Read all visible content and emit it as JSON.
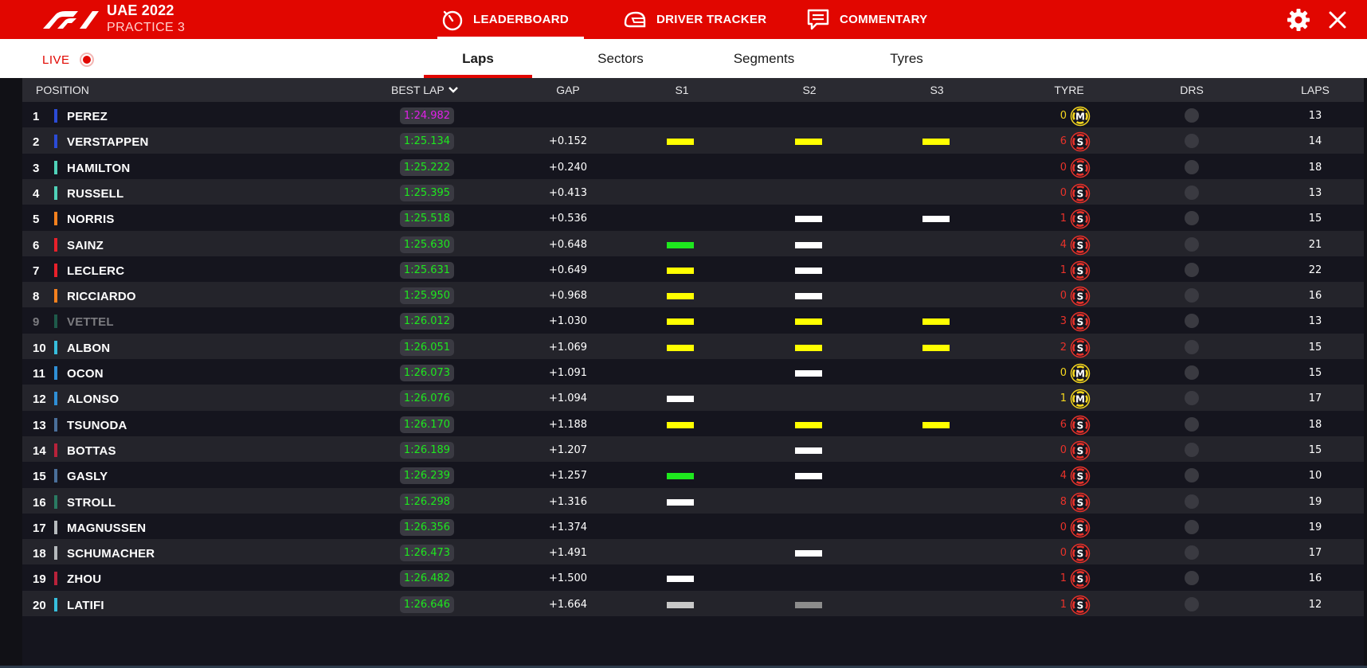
{
  "event": {
    "name": "UAE 2022",
    "session": "PRACTICE 3"
  },
  "main_tabs": [
    {
      "label": "LEADERBOARD",
      "icon": "stopwatch-icon",
      "active": true
    },
    {
      "label": "DRIVER TRACKER",
      "icon": "helmet-icon",
      "active": false
    },
    {
      "label": "COMMENTARY",
      "icon": "commentary-icon",
      "active": false
    }
  ],
  "live_label": "LIVE",
  "sub_tabs": [
    {
      "label": "Laps",
      "active": true
    },
    {
      "label": "Sectors",
      "active": false
    },
    {
      "label": "Segments",
      "active": false
    },
    {
      "label": "Tyres",
      "active": false
    }
  ],
  "headers": {
    "position": "POSITION",
    "best_lap": "BEST LAP",
    "gap": "GAP",
    "s1": "S1",
    "s2": "S2",
    "s3": "S3",
    "tyre": "TYRE",
    "drs": "DRS",
    "laps": "LAPS"
  },
  "colors": {
    "accent": "#e10600",
    "purple": "#e020e8",
    "green": "#1ee81e",
    "yellow": "#ffff00",
    "white": "#ffffff",
    "grey": "#c8c8c8",
    "dark_grey": "#8c8c8c",
    "tyre_soft": "#e8322a",
    "tyre_medium": "#f5d71e"
  },
  "rows": [
    {
      "pos": "1",
      "driver": "PEREZ",
      "team_color": "#2b4bd6",
      "best_lap": "1:24.982",
      "lap_color": "purple",
      "gap": "",
      "s1": null,
      "s2": null,
      "s3": null,
      "tyre_age": "0",
      "tyre": "M",
      "laps": "13"
    },
    {
      "pos": "2",
      "driver": "VERSTAPPEN",
      "team_color": "#2b4bd6",
      "best_lap": "1:25.134",
      "lap_color": "green",
      "gap": "+0.152",
      "s1": "yellow",
      "s2": "yellow",
      "s3": "yellow",
      "tyre_age": "6",
      "tyre": "S",
      "laps": "14"
    },
    {
      "pos": "3",
      "driver": "HAMILTON",
      "team_color": "#4fd1b8",
      "best_lap": "1:25.222",
      "lap_color": "green",
      "gap": "+0.240",
      "s1": null,
      "s2": null,
      "s3": null,
      "tyre_age": "0",
      "tyre": "S",
      "laps": "18"
    },
    {
      "pos": "4",
      "driver": "RUSSELL",
      "team_color": "#4fd1b8",
      "best_lap": "1:25.395",
      "lap_color": "green",
      "gap": "+0.413",
      "s1": null,
      "s2": null,
      "s3": null,
      "tyre_age": "0",
      "tyre": "S",
      "laps": "13"
    },
    {
      "pos": "5",
      "driver": "NORRIS",
      "team_color": "#f5811e",
      "best_lap": "1:25.518",
      "lap_color": "green",
      "gap": "+0.536",
      "s1": null,
      "s2": "white",
      "s3": "white",
      "tyre_age": "1",
      "tyre": "S",
      "laps": "15"
    },
    {
      "pos": "6",
      "driver": "SAINZ",
      "team_color": "#e8202a",
      "best_lap": "1:25.630",
      "lap_color": "green",
      "gap": "+0.648",
      "s1": "green",
      "s2": "white",
      "s3": null,
      "tyre_age": "4",
      "tyre": "S",
      "laps": "21"
    },
    {
      "pos": "7",
      "driver": "LECLERC",
      "team_color": "#e8202a",
      "best_lap": "1:25.631",
      "lap_color": "green",
      "gap": "+0.649",
      "s1": "yellow",
      "s2": "white",
      "s3": null,
      "tyre_age": "1",
      "tyre": "S",
      "laps": "22"
    },
    {
      "pos": "8",
      "driver": "RICCIARDO",
      "team_color": "#f5811e",
      "best_lap": "1:25.950",
      "lap_color": "green",
      "gap": "+0.968",
      "s1": "yellow",
      "s2": "white",
      "s3": null,
      "tyre_age": "0",
      "tyre": "S",
      "laps": "16"
    },
    {
      "pos": "9",
      "driver": "VETTEL",
      "team_color": "#1e5a4a",
      "best_lap": "1:26.012",
      "lap_color": "green",
      "gap": "+1.030",
      "s1": "yellow",
      "s2": "yellow",
      "s3": "yellow",
      "tyre_age": "3",
      "tyre": "S",
      "laps": "13",
      "dim": true
    },
    {
      "pos": "10",
      "driver": "ALBON",
      "team_color": "#37bedd",
      "best_lap": "1:26.051",
      "lap_color": "green",
      "gap": "+1.069",
      "s1": "yellow",
      "s2": "yellow",
      "s3": "yellow",
      "tyre_age": "2",
      "tyre": "S",
      "laps": "15"
    },
    {
      "pos": "11",
      "driver": "OCON",
      "team_color": "#2f8fd6",
      "best_lap": "1:26.073",
      "lap_color": "green",
      "gap": "+1.091",
      "s1": null,
      "s2": "white",
      "s3": null,
      "tyre_age": "0",
      "tyre": "M",
      "laps": "15"
    },
    {
      "pos": "12",
      "driver": "ALONSO",
      "team_color": "#2f8fd6",
      "best_lap": "1:26.076",
      "lap_color": "green",
      "gap": "+1.094",
      "s1": "white",
      "s2": null,
      "s3": null,
      "tyre_age": "1",
      "tyre": "M",
      "laps": "17"
    },
    {
      "pos": "13",
      "driver": "TSUNODA",
      "team_color": "#4a6f9a",
      "best_lap": "1:26.170",
      "lap_color": "green",
      "gap": "+1.188",
      "s1": "yellow",
      "s2": "yellow",
      "s3": "yellow",
      "tyre_age": "6",
      "tyre": "S",
      "laps": "18"
    },
    {
      "pos": "14",
      "driver": "BOTTAS",
      "team_color": "#b8223a",
      "best_lap": "1:26.189",
      "lap_color": "green",
      "gap": "+1.207",
      "s1": null,
      "s2": "white",
      "s3": null,
      "tyre_age": "0",
      "tyre": "S",
      "laps": "15"
    },
    {
      "pos": "15",
      "driver": "GASLY",
      "team_color": "#4a6f9a",
      "best_lap": "1:26.239",
      "lap_color": "green",
      "gap": "+1.257",
      "s1": "green",
      "s2": "white",
      "s3": null,
      "tyre_age": "4",
      "tyre": "S",
      "laps": "10"
    },
    {
      "pos": "16",
      "driver": "STROLL",
      "team_color": "#2a7a62",
      "best_lap": "1:26.298",
      "lap_color": "green",
      "gap": "+1.316",
      "s1": "white",
      "s2": null,
      "s3": null,
      "tyre_age": "8",
      "tyre": "S",
      "laps": "19"
    },
    {
      "pos": "17",
      "driver": "MAGNUSSEN",
      "team_color": "#b6babd",
      "best_lap": "1:26.356",
      "lap_color": "green",
      "gap": "+1.374",
      "s1": null,
      "s2": null,
      "s3": null,
      "tyre_age": "0",
      "tyre": "S",
      "laps": "19"
    },
    {
      "pos": "18",
      "driver": "SCHUMACHER",
      "team_color": "#b6babd",
      "best_lap": "1:26.473",
      "lap_color": "green",
      "gap": "+1.491",
      "s1": null,
      "s2": "white",
      "s3": null,
      "tyre_age": "0",
      "tyre": "S",
      "laps": "17"
    },
    {
      "pos": "19",
      "driver": "ZHOU",
      "team_color": "#b8223a",
      "best_lap": "1:26.482",
      "lap_color": "green",
      "gap": "+1.500",
      "s1": "white",
      "s2": null,
      "s3": null,
      "tyre_age": "1",
      "tyre": "S",
      "laps": "16"
    },
    {
      "pos": "20",
      "driver": "LATIFI",
      "team_color": "#37bedd",
      "best_lap": "1:26.646",
      "lap_color": "green",
      "gap": "+1.664",
      "s1": "grey",
      "s2": "dark_grey",
      "s3": null,
      "tyre_age": "1",
      "tyre": "S",
      "laps": "12"
    }
  ]
}
